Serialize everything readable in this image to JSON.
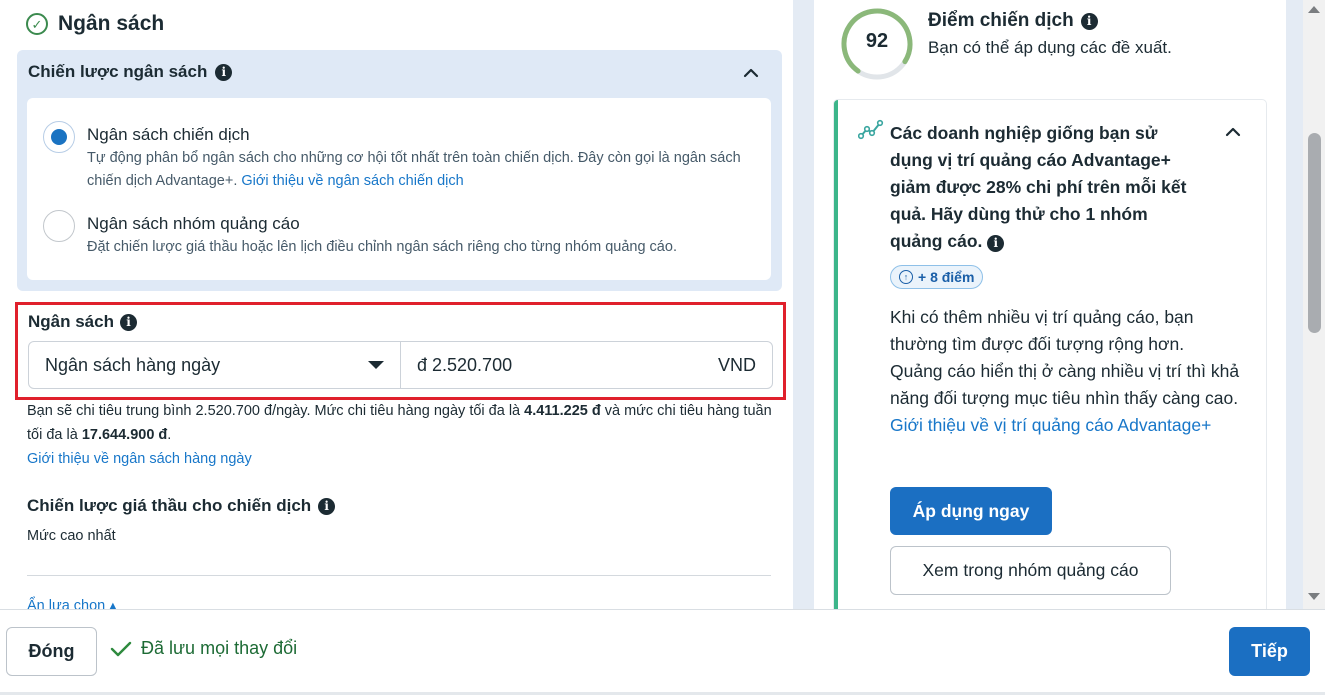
{
  "budget_section": {
    "title": "Ngân sách",
    "strategy": {
      "heading": "Chiến lược ngân sách",
      "options": [
        {
          "label": "Ngân sách chiến dịch",
          "description": "Tự động phân bổ ngân sách cho những cơ hội tốt nhất trên toàn chiến dịch. Đây còn gọi là ngân sách chiến dịch Advantage+.",
          "link": "Giới thiệu về ngân sách chiến dịch",
          "selected": true
        },
        {
          "label": "Ngân sách nhóm quảng cáo",
          "description": "Đặt chiến lược giá thầu hoặc lên lịch điều chỉnh ngân sách riêng cho từng nhóm quảng cáo.",
          "selected": false
        }
      ]
    },
    "budget": {
      "label": "Ngân sách",
      "type_selected": "Ngân sách hàng ngày",
      "amount": "đ 2.520.700",
      "currency": "VND"
    },
    "spend_note": {
      "part1": "Bạn sẽ chi tiêu trung bình 2.520.700 đ/ngày. Mức chi tiêu hàng ngày tối đa là ",
      "daily_max": "4.411.225 đ",
      "part2": " và mức chi tiêu hàng tuần tối đa là ",
      "weekly_max": "17.644.900 đ",
      "part3": "."
    },
    "daily_link": "Giới thiệu về ngân sách hàng ngày",
    "bid_strategy": {
      "title": "Chiến lược giá thầu cho chiến dịch",
      "value": "Mức cao nhất"
    },
    "hide_options": "Ẩn lựa chọn"
  },
  "score": {
    "value": "92",
    "progress": 0.92,
    "title": "Điểm chiến dịch",
    "subtitle": "Bạn có thể áp dụng các đề xuất."
  },
  "recommendation": {
    "heading": "Các doanh nghiệp giống bạn sử dụng vị trí quảng cáo Advantage+ giảm được 28% chi phí trên mỗi kết quả. Hãy dùng thử cho 1 nhóm quảng cáo.",
    "points": "+ 8 điểm",
    "body": "Khi có thêm nhiều vị trí quảng cáo, bạn thường tìm được đối tượng rộng hơn. Quảng cáo hiển thị ở càng nhiều vị trí thì khả năng đối tượng mục tiêu nhìn thấy càng cao.",
    "link": "Giới thiệu về vị trí quảng cáo Advantage+",
    "apply_label": "Áp dụng ngay",
    "view_label": "Xem trong nhóm quảng cáo"
  },
  "footer": {
    "close_label": "Đóng",
    "saved_text": "Đã lưu mọi thay đổi",
    "next_label": "Tiếp"
  },
  "colors": {
    "accent": "#1b6fc2",
    "highlight_border": "#e0202c",
    "score_ring": "#8bb87a",
    "rec_border": "#3cb58a"
  }
}
